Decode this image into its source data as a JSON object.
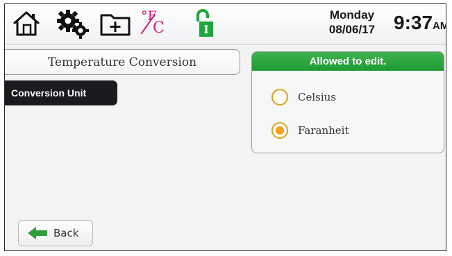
{
  "header": {
    "icons": [
      "home-icon",
      "settings-icon",
      "add-folder-icon",
      "temperature-unit-icon",
      "unlock-icon"
    ],
    "temp_icon_f": "°F",
    "temp_icon_c": "C",
    "unlock_letter": "I",
    "day": "Monday",
    "date": "08/06/17",
    "time": "9:37",
    "ampm": "AM"
  },
  "page": {
    "title": "Temperature Conversion",
    "sidebar_item": "Conversion Unit"
  },
  "panel": {
    "header": "Allowed to edit.",
    "header_color": "#2aa83f",
    "options": [
      {
        "label": "Celsius",
        "selected": false
      },
      {
        "label": "Faranheit",
        "selected": true
      }
    ],
    "radio_color": "#f5a21a"
  },
  "footer": {
    "back_label": "Back",
    "back_icon": "left-arrow-icon",
    "back_icon_color": "#2e9e3a"
  }
}
